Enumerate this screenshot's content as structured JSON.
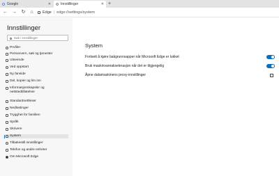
{
  "tabs": [
    {
      "label": "Google",
      "active": false
    },
    {
      "label": "Innstillinger",
      "active": true
    }
  ],
  "new_tab_glyph": "+",
  "toolbar": {
    "site_label": "Edge",
    "separator": "|",
    "url": "edge://settings/system"
  },
  "sidebar": {
    "title": "Innstillinger",
    "search_placeholder": "Søk i innstillinger",
    "items": [
      {
        "label": "Profiler",
        "icon": "person-icon"
      },
      {
        "label": "Personvern, søk og tjenester",
        "icon": "lock-icon"
      },
      {
        "label": "Utseende",
        "icon": "appearance-icon"
      },
      {
        "label": "Ved oppstart",
        "icon": "power-icon"
      },
      {
        "label": "Ny fanside",
        "icon": "newtab-icon"
      },
      {
        "label": "Del, kopier og lim inn",
        "icon": "share-icon"
      },
      {
        "label": "Informasjonskapsler og nettstedtillatelser",
        "icon": "cookie-icon"
      },
      {
        "label": "Standardnettleser",
        "icon": "browser-icon"
      },
      {
        "label": "Nedlastinger",
        "icon": "download-icon"
      },
      {
        "label": "Trygghet for familien",
        "icon": "family-icon"
      },
      {
        "label": "Språk",
        "icon": "language-icon"
      },
      {
        "label": "Skrivere",
        "icon": "printer-icon"
      },
      {
        "label": "System",
        "icon": "system-icon",
        "active": true
      },
      {
        "label": "Tilbakestill innstillinger",
        "icon": "reset-icon"
      },
      {
        "label": "Telefon og andre enheter",
        "icon": "phone-icon"
      },
      {
        "label": "Om Microsoft Edge",
        "icon": "edge-logo-icon"
      }
    ]
  },
  "main": {
    "title": "System",
    "settings": [
      {
        "label": "Fortsett å kjøre bakgrunnsapper når Microsoft Edge er lukket",
        "control": "toggle",
        "on": true
      },
      {
        "label": "Bruk maskinvareakselerasjon når det er tilgjengelig",
        "control": "toggle",
        "on": true
      },
      {
        "label": "Åpne datamaskinens proxy-innstillinger",
        "control": "external-link-icon"
      }
    ]
  },
  "colors": {
    "accent": "#0a6ec0",
    "sidebar_bg": "#f7f7f7",
    "tabstrip_bg": "#e3e3e3"
  }
}
